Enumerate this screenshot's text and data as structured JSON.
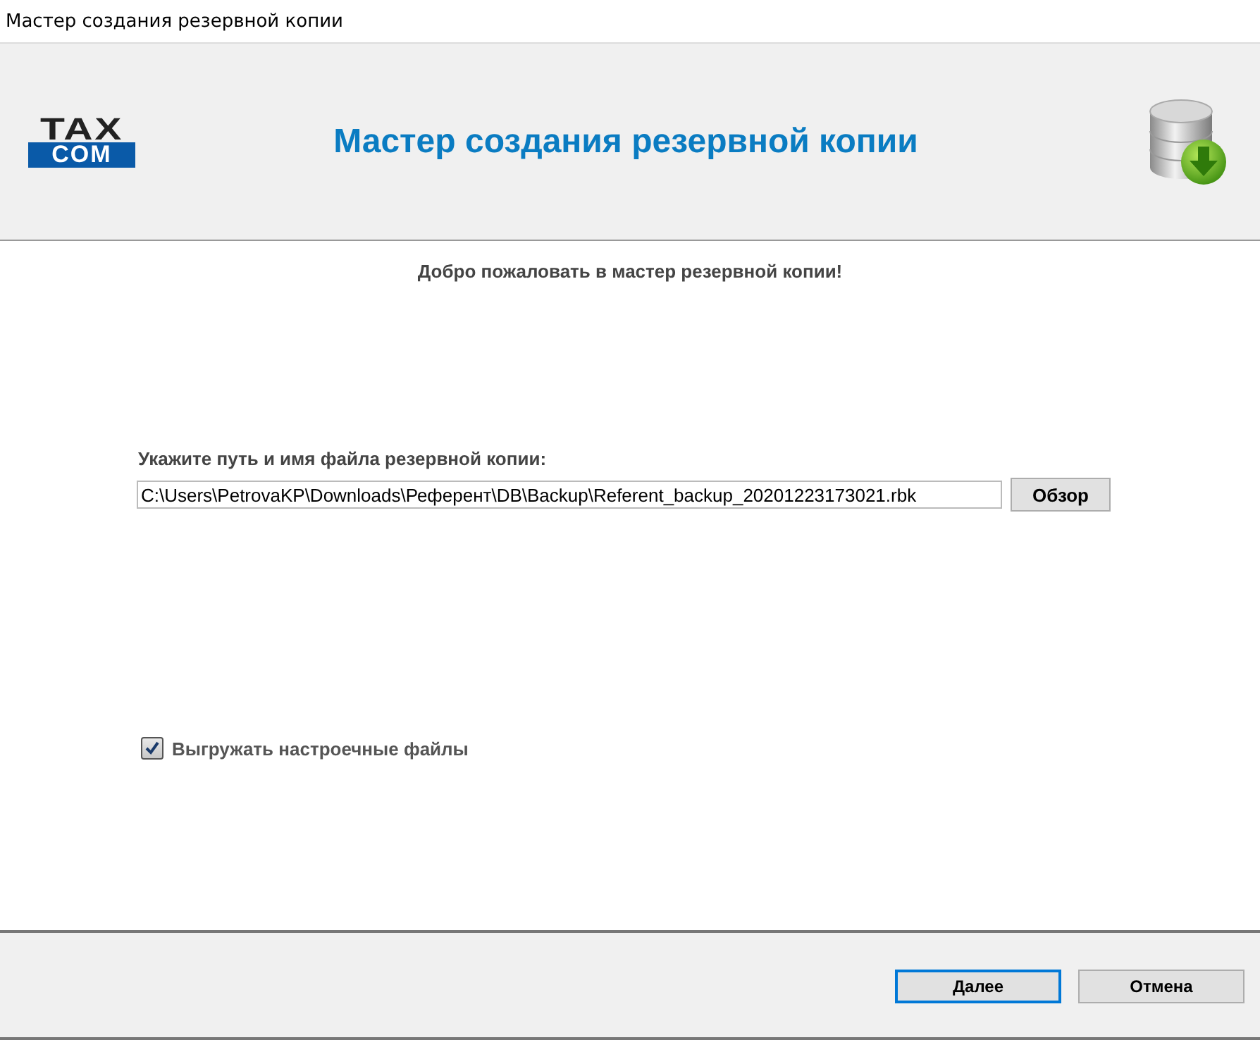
{
  "window": {
    "title": "Мастер создания резервной копии"
  },
  "header": {
    "logo": [
      "TAX",
      "COM"
    ],
    "title": "Мастер создания резервной копии"
  },
  "welcome": "Добро пожаловать в мастер резервной копии!",
  "path": {
    "label": "Укажите путь и имя файла резервной копии:",
    "value": "C:\\Users\\PetrovaKP\\Downloads\\Референт\\DB\\Backup\\Referent_backup_20201223173021.rbk",
    "browse": "Обзор"
  },
  "export_settings": {
    "label": "Выгружать настроечные файлы",
    "checked": true
  },
  "buttons": [
    {
      "label": "Далее",
      "default": true
    },
    {
      "label": "Отмена",
      "default": false
    }
  ]
}
